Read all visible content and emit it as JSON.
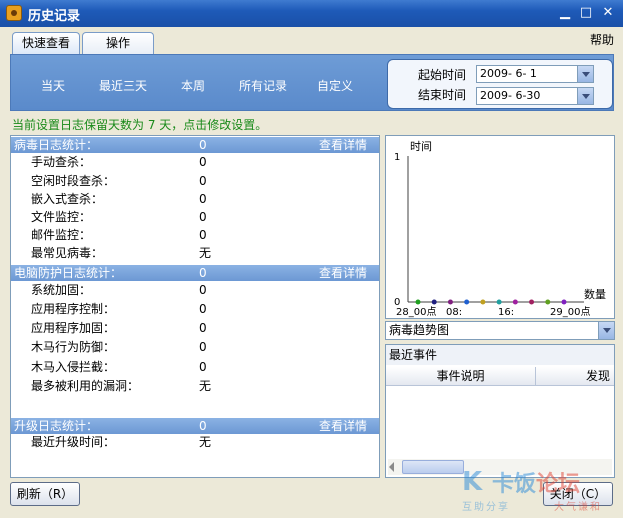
{
  "window": {
    "title": "历史记录"
  },
  "tabs": [
    {
      "label": "快速查看",
      "active": true
    },
    {
      "label": "操作",
      "active": false
    }
  ],
  "help_label": "帮助",
  "quick_links": [
    "当天",
    "最近三天",
    "本周",
    "所有记录",
    "自定义"
  ],
  "date_range": {
    "start_label": "起始时间",
    "start_value": "2009- 6- 1",
    "end_label": "结束时间",
    "end_value": "2009- 6-30"
  },
  "notice": "当前设置日志保留天数为 7 天，点击修改设置。",
  "sections": {
    "virus": {
      "title": "病毒日志统计：",
      "value": "0",
      "detail": "查看详情",
      "rows": [
        {
          "label": "手动查杀：",
          "value": "0"
        },
        {
          "label": "空闲时段查杀：",
          "value": "0"
        },
        {
          "label": "嵌入式查杀：",
          "value": "0"
        },
        {
          "label": "文件监控：",
          "value": "0"
        },
        {
          "label": "邮件监控：",
          "value": "0"
        },
        {
          "label": "最常见病毒：",
          "value": "无"
        }
      ]
    },
    "protection": {
      "title": "电脑防护日志统计：",
      "value": "0",
      "detail": "查看详情",
      "rows": [
        {
          "label": "系统加固：",
          "value": "0"
        },
        {
          "label": "应用程序控制：",
          "value": "0"
        },
        {
          "label": "应用程序加固：",
          "value": "0"
        },
        {
          "label": "木马行为防御：",
          "value": "0"
        },
        {
          "label": "木马入侵拦截：",
          "value": "0"
        },
        {
          "label": "最多被利用的漏洞：",
          "value": "无"
        }
      ]
    },
    "upgrade": {
      "title": "升级日志统计：",
      "value": "0",
      "detail": "查看详情",
      "rows": [
        {
          "label": "最近升级时间：",
          "value": "无"
        }
      ]
    }
  },
  "chart_data": {
    "type": "line",
    "ylabel": "时间",
    "xlabel": "数量",
    "y_ticks": [
      "0",
      "1"
    ],
    "x_tick_labels": [
      "28_00点",
      "08:",
      "16:",
      "29_00点"
    ],
    "ylim": [
      0,
      1
    ],
    "points": [
      0,
      0,
      0,
      0,
      0,
      0,
      0,
      0,
      0,
      0
    ],
    "point_colors": [
      "#20A020",
      "#202080",
      "#802080",
      "#2060D0",
      "#C0A020",
      "#20A0A0",
      "#A020A0",
      "#A02060",
      "#60A020",
      "#8020C0"
    ]
  },
  "chart_select": {
    "value": "病毒趋势图"
  },
  "events": {
    "title": "最近事件",
    "columns": [
      "事件说明",
      "发现"
    ]
  },
  "buttons": {
    "refresh": "刷新（R）",
    "close": "关闭（C）"
  },
  "watermark": {
    "main": "卡饭",
    "accent": "论坛",
    "sub1": "互助分享",
    "sub2": "大气谦和"
  }
}
